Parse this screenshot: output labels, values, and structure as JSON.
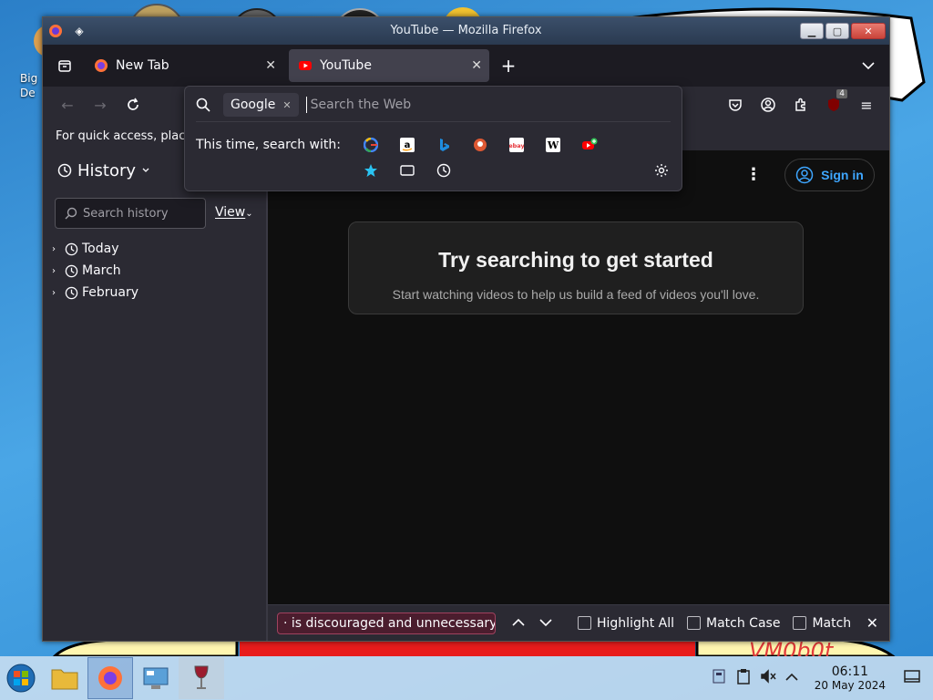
{
  "window": {
    "title": "YouTube — Mozilla Firefox"
  },
  "desktop": {
    "icon_label": "Big De",
    "watermark": "VM0b0t"
  },
  "tabs": [
    {
      "label": "New Tab",
      "active": false
    },
    {
      "label": "YouTube",
      "active": true
    }
  ],
  "urlbar": {
    "engine": "Google",
    "placeholder": "Search the Web",
    "search_with_label": "This time, search with:",
    "engines": [
      "google-icon",
      "amazon-icon",
      "bing-icon",
      "duckduckgo-icon",
      "ebay-icon",
      "wikipedia-icon",
      "youtube-add-icon"
    ],
    "modes": [
      "bookmarks-icon",
      "tabs-icon",
      "history-icon"
    ]
  },
  "bookmarks_bar": {
    "text": "For quick access, plac"
  },
  "extensions": {
    "badge": "4"
  },
  "sidebar": {
    "title": "History",
    "search_placeholder": "Search history",
    "view_label": "View",
    "items": [
      {
        "label": "Today"
      },
      {
        "label": "March"
      },
      {
        "label": "February"
      }
    ]
  },
  "youtube": {
    "signin_label": "Sign in",
    "card_title": "Try searching to get started",
    "card_subtitle": "Start watching videos to help us build a feed of videos you'll love."
  },
  "findbar": {
    "query": "· is discouraged and unnecessary.",
    "highlight_all": "Highlight All",
    "match_case": "Match Case",
    "match_diacritics": "Match"
  },
  "taskbar": {
    "time": "06:11",
    "date": "20 May 2024"
  },
  "colors": {
    "accent": "#3ea6ff",
    "find_bg": "#4b1d2e",
    "window_bg": "#1c1b22"
  }
}
